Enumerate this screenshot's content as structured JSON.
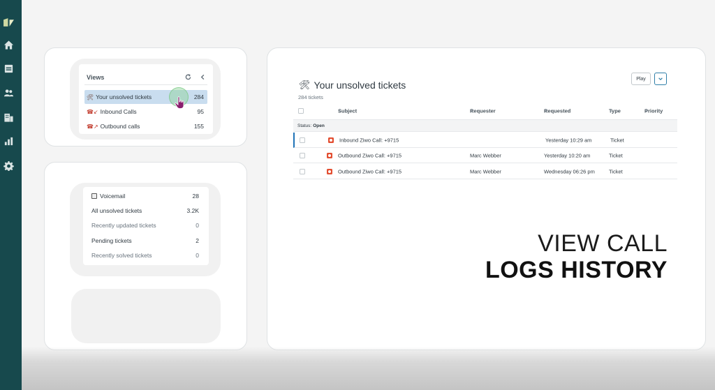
{
  "views": {
    "title": "Views",
    "items": [
      {
        "icon": "🛠",
        "label": "Your unsolved tickets",
        "count": "284"
      },
      {
        "icon": "☎↙",
        "label": "Inbound Calls",
        "count": "95"
      },
      {
        "icon": "☎↗",
        "label": "Outbound calls",
        "count": "155"
      }
    ]
  },
  "views2": {
    "items": [
      {
        "label": "Voicemail",
        "count": "28"
      },
      {
        "label": "All unsolved tickets",
        "count": "3.2K"
      },
      {
        "label": "Recently updated tickets",
        "count": "0"
      },
      {
        "label": "Pending tickets",
        "count": "2"
      },
      {
        "label": "Recently solved tickets",
        "count": "0"
      }
    ]
  },
  "main": {
    "title": "Your unsolved tickets",
    "count": "284 tickets",
    "play_label": "Play",
    "columns": {
      "subject": "Subject",
      "requester": "Requester",
      "requested": "Requested",
      "type": "Type",
      "priority": "Priority"
    },
    "group_label": "Status:",
    "group_value": "Open",
    "rows": [
      {
        "subject": "Inbound Ziwo Call: +9715",
        "requester": "",
        "requested": "Yesterday 10:29 am",
        "type": "Ticket"
      },
      {
        "subject": "Outbound Ziwo Call: +9715",
        "requester": "Marc Webber",
        "requested": "Yesterday 10:20 am",
        "type": "Ticket"
      },
      {
        "subject": "Outbound Ziwo Call: +9715",
        "requester": "Marc Webber",
        "requested": "Wednesday 06:26 pm",
        "type": "Ticket"
      }
    ]
  },
  "overlay": {
    "line1": "VIEW CALL",
    "line2": "LOGS HISTORY"
  },
  "colors": {
    "rail": "#17494d",
    "selected": "#c9ddef",
    "accent": "#1f73b7",
    "ticket_icon": "#e34f32"
  }
}
